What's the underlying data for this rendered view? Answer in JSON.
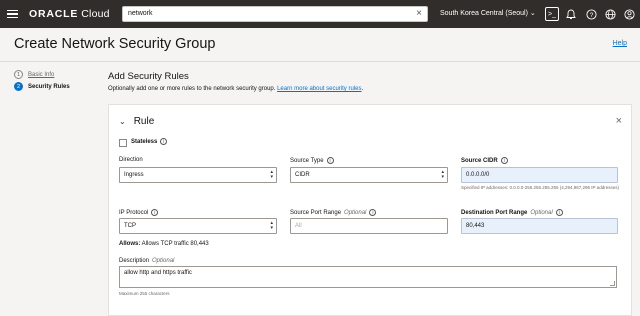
{
  "header": {
    "brand_bold": "ORACLE",
    "brand_rest": " Cloud",
    "search_value": "network",
    "region": "South Korea Central (Seoul)",
    "icons": [
      "menu-icon",
      "close-icon",
      "chevron-down-icon",
      "cloud-shell-icon",
      "bell-icon",
      "help-icon",
      "globe-icon",
      "user-icon"
    ]
  },
  "page": {
    "title": "Create Network Security Group",
    "help": "Help"
  },
  "steps": [
    {
      "num": "1",
      "label": "Basic Info"
    },
    {
      "num": "2",
      "label": "Security Rules"
    }
  ],
  "section": {
    "title": "Add Security Rules",
    "desc": "Optionally add one or more rules to the network security group.",
    "link": "Learn more about security rules",
    "period": "."
  },
  "rule": {
    "title": "Rule",
    "stateless": "Stateless",
    "direction_label": "Direction",
    "direction_value": "Ingress",
    "source_type_label": "Source Type",
    "source_type_value": "CIDR",
    "source_cidr_label": "Source CIDR",
    "source_cidr_value": "0.0.0.0/0",
    "source_cidr_hint": "Specified IP addresses: 0.0.0.0-255.255.255.255 (4,294,967,296 IP addresses)",
    "ip_protocol_label": "IP Protocol",
    "ip_protocol_value": "TCP",
    "source_port_label": "Source Port Range",
    "optional": "Optional",
    "source_port_placeholder": "All",
    "dest_port_label": "Destination Port Range",
    "dest_port_value": "80,443",
    "allows_label": "Allows:",
    "allows_text": " Allows TCP traffic 80,443",
    "description_label": "Description",
    "description_value": "allow http and https traffic",
    "description_hint": "Maximum 255 characters"
  }
}
